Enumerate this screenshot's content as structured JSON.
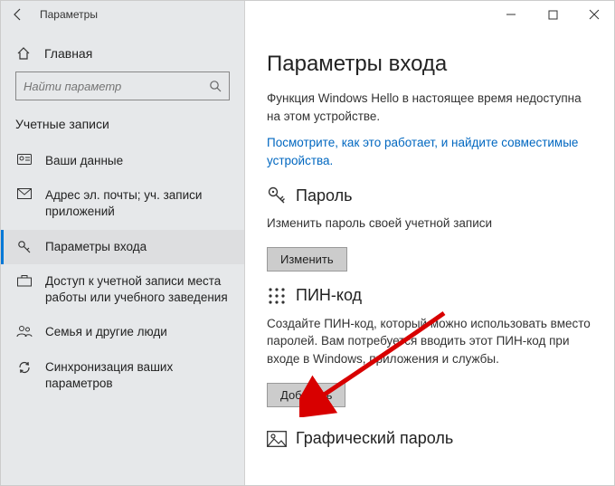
{
  "window": {
    "title": "Параметры"
  },
  "sidebar": {
    "home": "Главная",
    "search_placeholder": "Найти параметр",
    "section": "Учетные записи",
    "items": [
      {
        "label": "Ваши данные"
      },
      {
        "label": "Адрес эл. почты; уч. записи приложений"
      },
      {
        "label": "Параметры входа"
      },
      {
        "label": "Доступ к учетной записи места работы или учебного заведения"
      },
      {
        "label": "Семья и другие люди"
      },
      {
        "label": "Синхронизация ваших параметров"
      }
    ]
  },
  "main": {
    "heading": "Параметры входа",
    "hello_text": "Функция Windows Hello в настоящее время недоступна на этом устройстве.",
    "hello_link": "Посмотрите, как это работает, и найдите совместимые устройства.",
    "password": {
      "title": "Пароль",
      "desc": "Изменить пароль своей учетной записи",
      "button": "Изменить"
    },
    "pin": {
      "title": "ПИН-код",
      "desc": "Создайте ПИН-код, который можно использовать вместо паролей. Вам потребуется вводить этот ПИН-код при входе в Windows, приложения и службы.",
      "button": "Добавить"
    },
    "picture": {
      "title": "Графический пароль"
    }
  }
}
